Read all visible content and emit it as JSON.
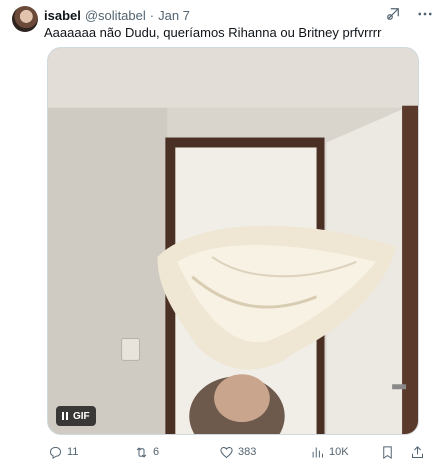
{
  "tweet": {
    "display_name": "isabel",
    "handle": "@solitabel",
    "separator": "·",
    "date": "Jan 7",
    "text": "Aaaaaaa não Dudu, queríamos Rihanna ou Britney prfvrrrr"
  },
  "media": {
    "badge_label": "GIF",
    "badge_icon": "pause-icon"
  },
  "actions": {
    "reply_count": "11",
    "retweet_count": "6",
    "like_count": "383",
    "views_count": "10K"
  },
  "icons": {
    "header": [
      "grok-icon",
      "more-icon"
    ],
    "actions": [
      "reply-icon",
      "retweet-icon",
      "like-icon",
      "views-icon",
      "bookmark-icon",
      "share-icon"
    ]
  },
  "colors": {
    "text_primary": "#0f1419",
    "text_secondary": "#536471",
    "border": "#cfd9de"
  }
}
